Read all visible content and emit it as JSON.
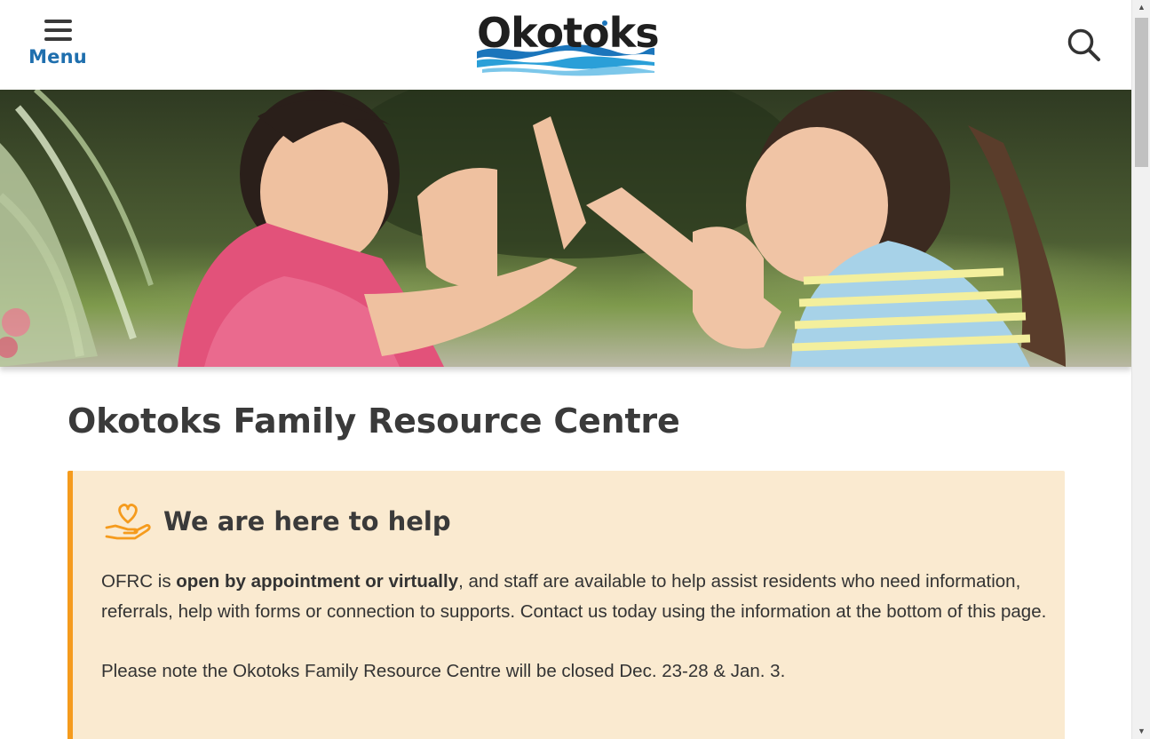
{
  "header": {
    "menu_label": "Menu",
    "logo_text": "Okotoks",
    "search_icon": "search-icon",
    "menu_icon": "hamburger-icon"
  },
  "hero": {
    "image": "children-playing-hand-clap"
  },
  "main": {
    "page_title": "Okotoks Family Resource Centre",
    "notice": {
      "icon": "heart-hand-icon",
      "title": "We are here to help",
      "paragraph1_prefix": "OFRC is ",
      "paragraph1_bold": "open by appointment or virtually",
      "paragraph1_suffix": ", and staff are available to help assist residents who need information, referrals, help with forms or connection to supports. Contact us today using the information at the bottom of this page.",
      "paragraph2": "Please note the Okotoks Family Resource Centre will be closed Dec. 23-28 & Jan. 3."
    }
  },
  "colors": {
    "brand_blue": "#1f6fae",
    "accent_orange": "#f59b1d",
    "notice_bg": "#faead0",
    "text_dark": "#3a3a3a"
  },
  "scrollbar": {
    "up_arrow": "▲",
    "down_arrow": "▼"
  }
}
